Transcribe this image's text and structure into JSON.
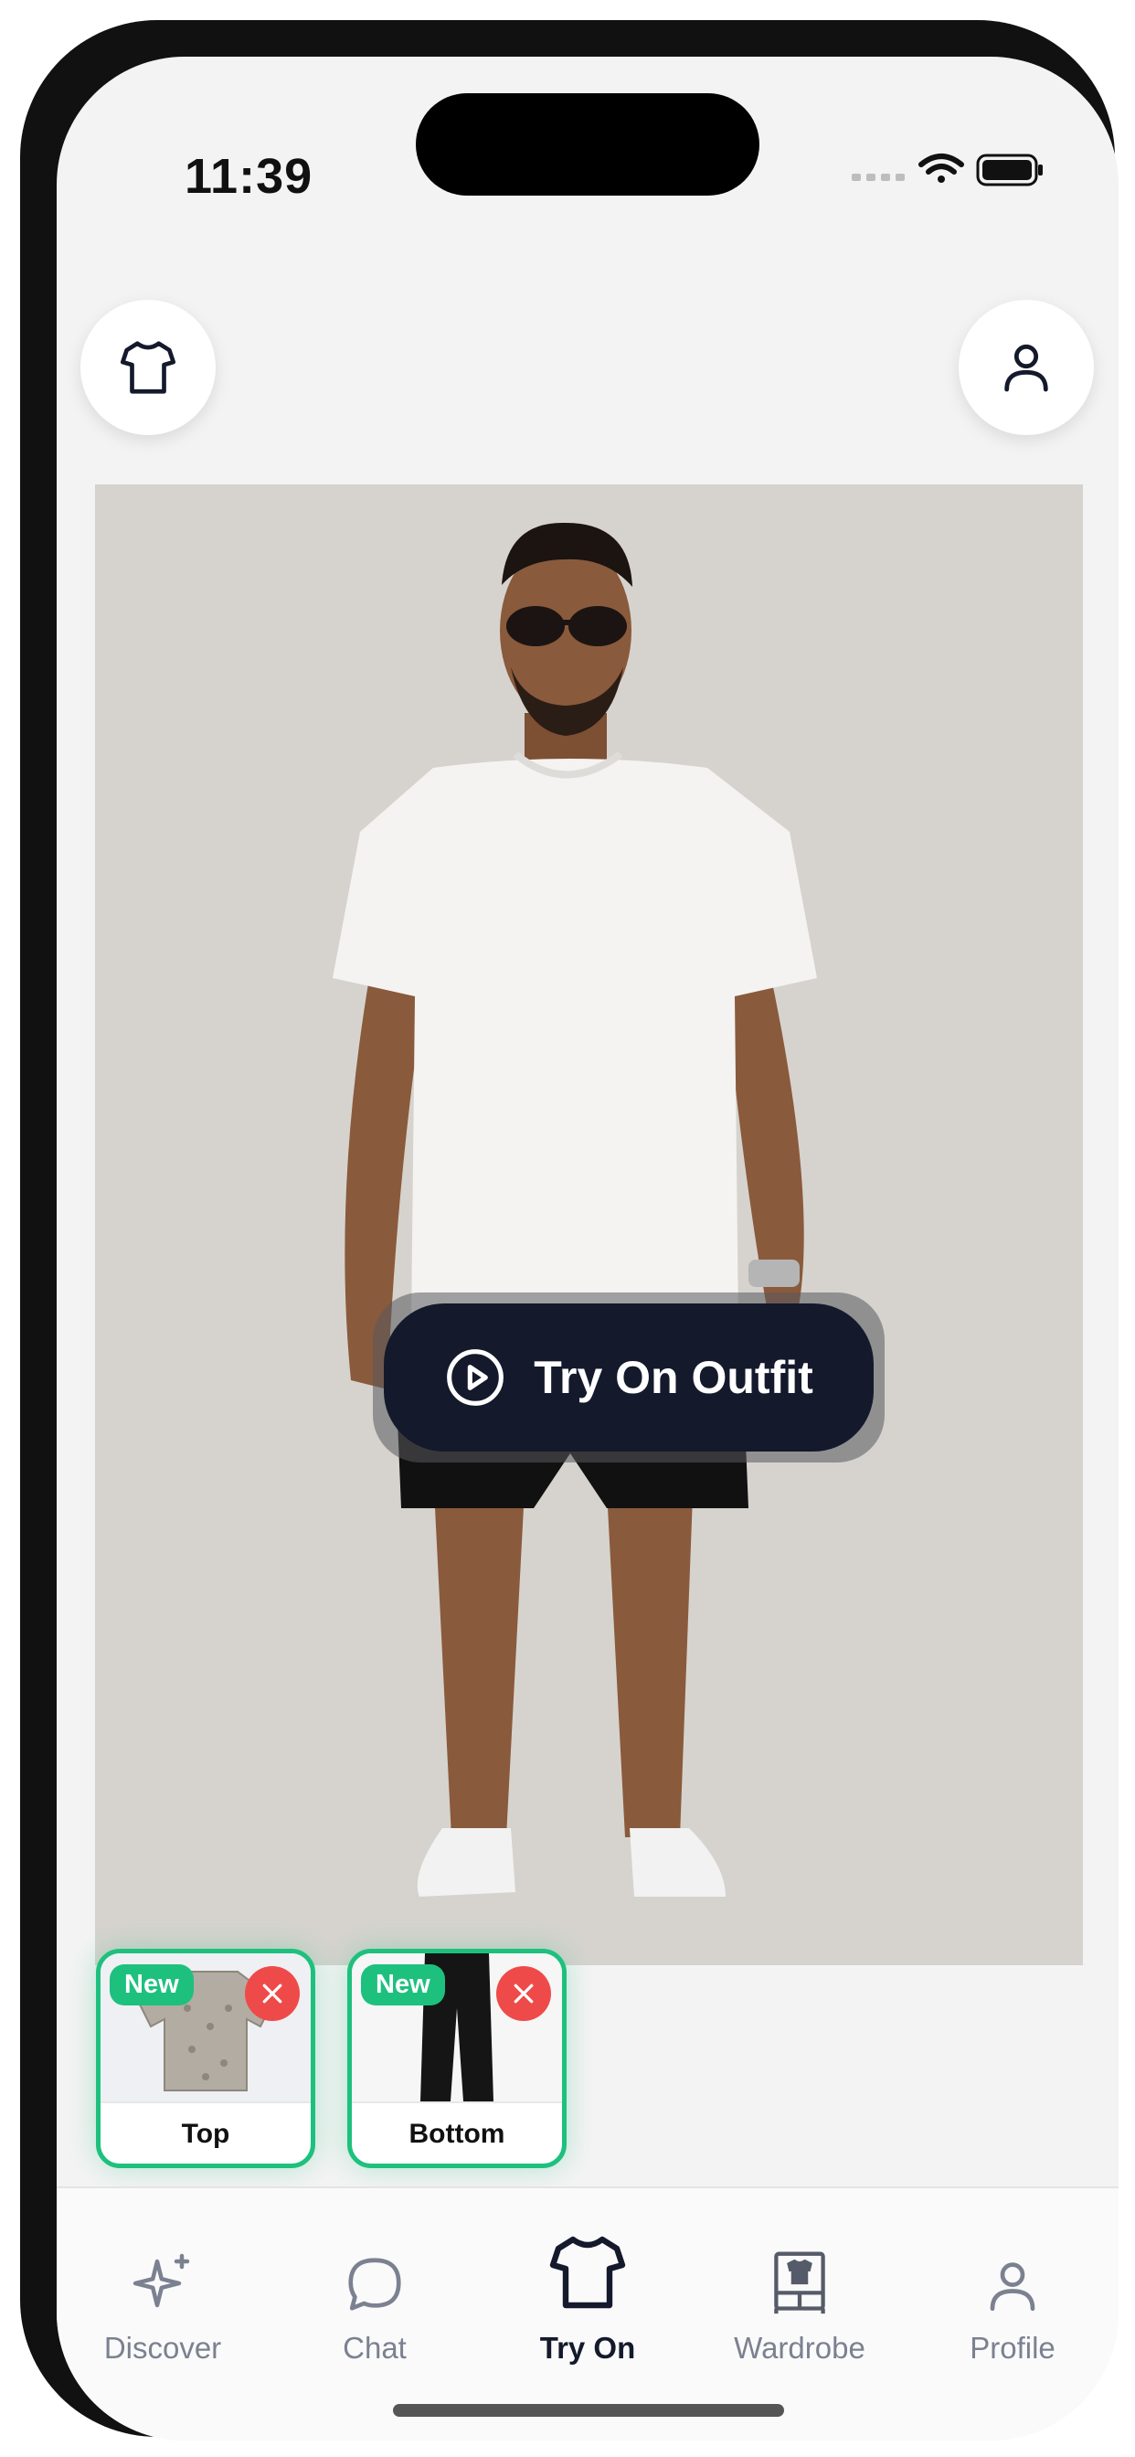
{
  "status_bar": {
    "time": "11:39"
  },
  "try_on_button": {
    "label": "Try On Outfit"
  },
  "selected_items": [
    {
      "badge": "New",
      "label": "Top"
    },
    {
      "badge": "New",
      "label": "Bottom"
    }
  ],
  "tab_bar": {
    "items": [
      {
        "label": "Discover",
        "icon": "sparkle-icon"
      },
      {
        "label": "Chat",
        "icon": "chat-bubble-icon"
      },
      {
        "label": "Try On",
        "icon": "tshirt-icon",
        "active": true
      },
      {
        "label": "Wardrobe",
        "icon": "wardrobe-icon"
      },
      {
        "label": "Profile",
        "icon": "person-icon"
      }
    ]
  },
  "colors": {
    "accent": "#1ec07e",
    "dark": "#141a2c",
    "remove": "#ef4a4a"
  }
}
